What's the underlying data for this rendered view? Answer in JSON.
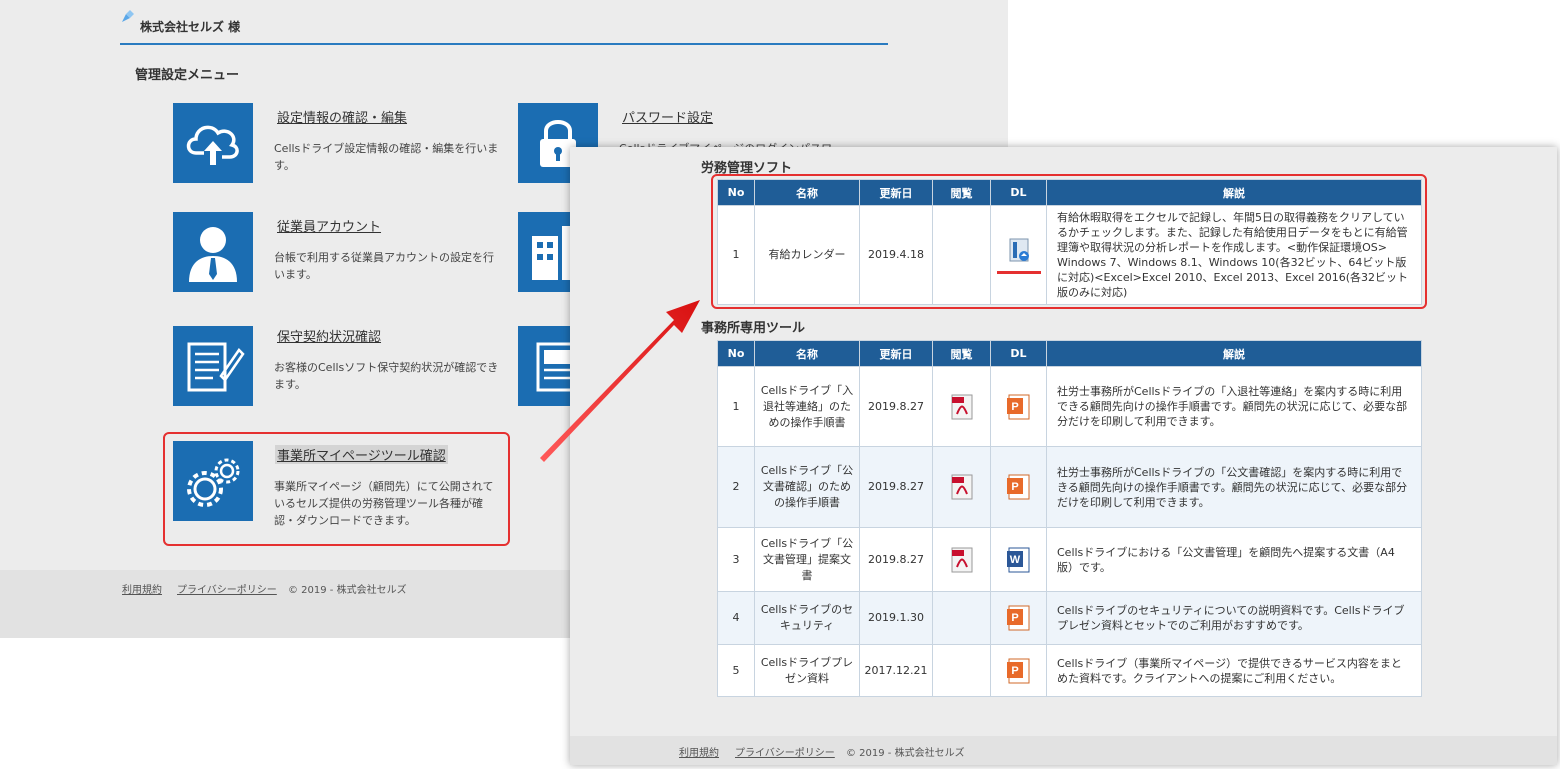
{
  "back": {
    "company": "株式会社セルズ 様",
    "section_title": "管理設定メニュー",
    "menu": [
      {
        "title": "設定情報の確認・編集",
        "desc": "Cellsドライブ設定情報の確認・編集を行います。",
        "icon": "cloud-upload-icon"
      },
      {
        "title": "従業員アカウント",
        "desc": "台帳で利用する従業員アカウントの設定を行います。",
        "icon": "employee-icon"
      },
      {
        "title": "保守契約状況確認",
        "desc": "お客様のCellsソフト保守契約状況が確認できます。",
        "icon": "document-pen-icon"
      },
      {
        "title": "事業所マイページツール確認",
        "desc": "事業所マイページ（顧問先）にて公開されているセルズ提供の労務管理ツール各種が確認・ダウンロードできます。",
        "icon": "gears-icon"
      }
    ],
    "menu_right": [
      {
        "title": "パスワード設定",
        "desc": "Cellsドライブマイページのログインパスワ",
        "icon": "lock-icon"
      },
      {
        "icon": "building-icon"
      },
      {
        "icon": "newspaper-icon"
      }
    ],
    "footer": {
      "terms": "利用規約",
      "privacy": "プライバシーポリシー",
      "copyright": "© 2019 - 株式会社セルズ"
    }
  },
  "front": {
    "section1_title": "労務管理ソフト",
    "section2_title": "事務所専用ツール",
    "headers": [
      "No",
      "名称",
      "更新日",
      "閲覧",
      "DL",
      "解説"
    ],
    "table1": [
      {
        "no": "1",
        "name": "有給カレンダー",
        "date": "2019.4.18",
        "view": "",
        "dl": "installer",
        "desc": "有給休暇取得をエクセルで記録し、年間5日の取得義務をクリアしているかチェックします。また、記録した有給使用日データをもとに有給管理簿や取得状況の分析レポートを作成します。<動作保証環境OS> Windows 7、Windows 8.1、Windows 10(各32ビット、64ビット版に対応)<Excel>Excel 2010、Excel 2013、Excel 2016(各32ビット版のみに対応)"
      }
    ],
    "table2": [
      {
        "no": "1",
        "name": "Cellsドライブ「入退社等連絡」のための操作手順書",
        "date": "2019.8.27",
        "view": "pdf",
        "dl": "ppt",
        "desc": "社労士事務所がCellsドライブの「入退社等連絡」を案内する時に利用できる顧問先向けの操作手順書です。顧問先の状況に応じて、必要な部分だけを印刷して利用できます。"
      },
      {
        "no": "2",
        "name": "Cellsドライブ「公文書確認」のための操作手順書",
        "date": "2019.8.27",
        "view": "pdf",
        "dl": "ppt",
        "desc": "社労士事務所がCellsドライブの「公文書確認」を案内する時に利用できる顧問先向けの操作手順書です。顧問先の状況に応じて、必要な部分だけを印刷して利用できます。"
      },
      {
        "no": "3",
        "name": "Cellsドライブ「公文書管理」提案文書",
        "date": "2019.8.27",
        "view": "pdf",
        "dl": "word",
        "desc": "Cellsドライブにおける「公文書管理」を顧問先へ提案する文書（A4版）です。"
      },
      {
        "no": "4",
        "name": "Cellsドライブのセキュリティ",
        "date": "2019.1.30",
        "view": "",
        "dl": "ppt",
        "desc": "Cellsドライブのセキュリティについての説明資料です。Cellsドライブプレゼン資料とセットでのご利用がおすすめです。"
      },
      {
        "no": "5",
        "name": "Cellsドライブプレゼン資料",
        "date": "2017.12.21",
        "view": "",
        "dl": "ppt",
        "desc": "Cellsドライブ（事業所マイページ）で提供できるサービス内容をまとめた資料です。クライアントへの提案にご利用ください。"
      }
    ],
    "footer": {
      "terms": "利用規約",
      "privacy": "プライバシーポリシー",
      "copyright": "© 2019 - 株式会社セルズ"
    }
  },
  "colors": {
    "tile": "#1b6db2",
    "table_header": "#1f5d97",
    "highlight_red": "#e53030"
  }
}
